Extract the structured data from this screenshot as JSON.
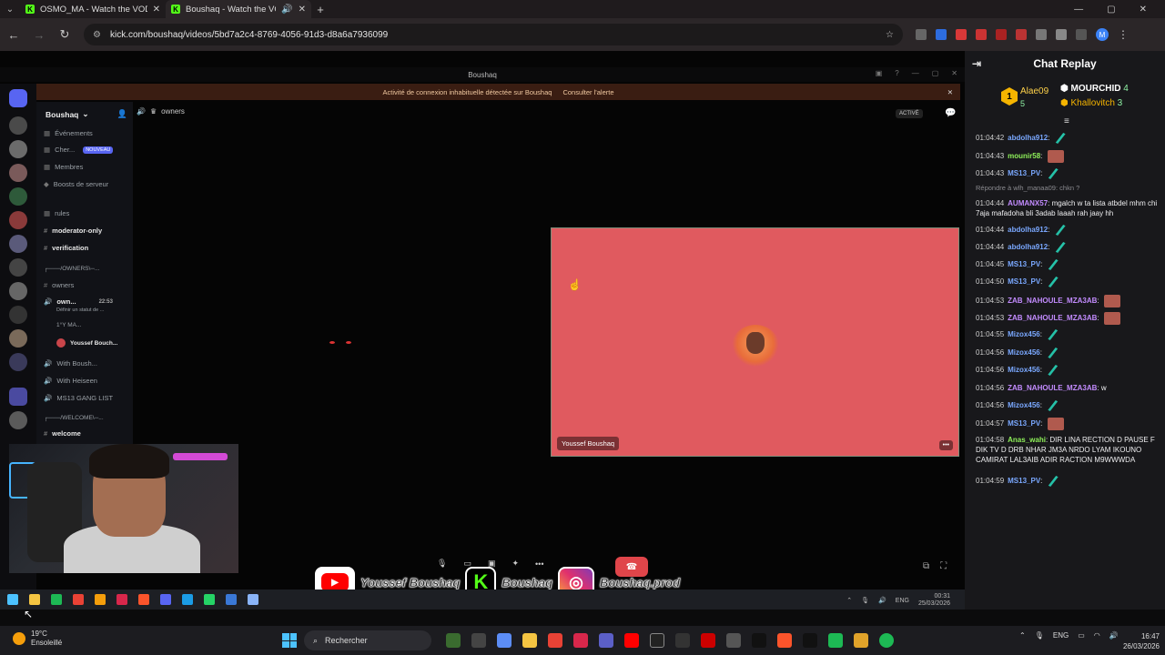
{
  "browser": {
    "tabs": [
      {
        "title": "OSMO_MA - Watch the VOD o"
      },
      {
        "title": "Boushaq - Watch the VOD o"
      }
    ],
    "url": "kick.com/boushaq/videos/5bd7a2c4-8769-4056-91d3-d8a6a7936099",
    "profile_initial": "M"
  },
  "discord": {
    "window_title": "Boushaq",
    "alert_text": "Activité de connexion inhabituelle détectée sur Boushaq",
    "alert_link": "Consulter l'alerte",
    "server_name": "Boushaq",
    "channel_header": "owners",
    "status_pill": "ACTIVÉ",
    "channels": [
      {
        "label": "Événements"
      },
      {
        "label": "Cher...",
        "badge": "NOUVEAU"
      },
      {
        "label": "Membres"
      },
      {
        "label": "Boosts de serveur"
      },
      {
        "label": "rules"
      },
      {
        "label": "moderator-only"
      },
      {
        "label": "verification"
      },
      {
        "label": "┌───/OWNERS\\─..."
      },
      {
        "label": "owners"
      },
      {
        "label": "own...",
        "time": "22:53"
      },
      {
        "label": "Définir un statut de ..."
      },
      {
        "label": "1°Y MA..."
      },
      {
        "label": "Youssef Bouch..."
      },
      {
        "label": "With Boush..."
      },
      {
        "label": "With Heiseen"
      },
      {
        "label": "MS13 GANG LIST"
      },
      {
        "label": "┌───/WELCOME\\─..."
      },
      {
        "label": "welcome"
      }
    ],
    "tile_name": "Youssef Boushaq"
  },
  "overlay": {
    "youtube": "Youssef Boushaq",
    "kick": "Boushaq",
    "instagram": "Boushaq.prod"
  },
  "inner_taskbar": {
    "lang": "ENG",
    "time": "00:31",
    "date": "25/03/2026"
  },
  "chat": {
    "title": "Chat Replay",
    "leaderboard": {
      "first_rank": "1",
      "first_name": "Alae09",
      "first_count": "5",
      "second_name": "MOURCHID",
      "second_count": "4",
      "third_name": "Khallovitch",
      "third_count": "3"
    },
    "reply_note": "Répondre à wlh_manaa09: chkn ?",
    "messages": [
      {
        "time": "01:04:42",
        "user": "abdolha912",
        "color": "#7aa8ff",
        "text": "",
        "emote": "feather"
      },
      {
        "time": "01:04:43",
        "user": "mounir58",
        "color": "#8ef05a",
        "text": "",
        "emote": "face"
      },
      {
        "time": "01:04:43",
        "user": "MS13_PV",
        "color": "#7aa8ff",
        "text": "",
        "emote": "feather"
      },
      {
        "time": "01:04:44",
        "user": "AUMANX57",
        "color": "#c38cff",
        "text": "mgalch w ta lista atbdel mhm chi 7aja mafadoha bli 3adab laaah rah jaay hh",
        "emote": ""
      },
      {
        "time": "01:04:44",
        "user": "abdolha912",
        "color": "#7aa8ff",
        "text": "",
        "emote": "feather"
      },
      {
        "time": "01:04:44",
        "user": "abdolha912",
        "color": "#7aa8ff",
        "text": "",
        "emote": "feather"
      },
      {
        "time": "01:04:45",
        "user": "MS13_PV",
        "color": "#7aa8ff",
        "text": "",
        "emote": "feather"
      },
      {
        "time": "01:04:50",
        "user": "MS13_PV",
        "color": "#7aa8ff",
        "text": "",
        "emote": "feather"
      },
      {
        "time": "01:04:53",
        "user": "ZAB_NAHOULE_MZA3AB",
        "color": "#c38cff",
        "text": "",
        "emote": "face"
      },
      {
        "time": "01:04:53",
        "user": "ZAB_NAHOULE_MZA3AB",
        "color": "#c38cff",
        "text": "",
        "emote": "face"
      },
      {
        "time": "01:04:55",
        "user": "Mizox456",
        "color": "#7aa8ff",
        "text": "",
        "emote": "feather"
      },
      {
        "time": "01:04:56",
        "user": "Mizox456",
        "color": "#7aa8ff",
        "text": "",
        "emote": "feather"
      },
      {
        "time": "01:04:56",
        "user": "Mizox456",
        "color": "#7aa8ff",
        "text": "",
        "emote": "feather"
      },
      {
        "time": "01:04:56",
        "user": "ZAB_NAHOULE_MZA3AB",
        "color": "#c38cff",
        "text": "w",
        "emote": ""
      },
      {
        "time": "01:04:56",
        "user": "Mizox456",
        "color": "#7aa8ff",
        "text": "",
        "emote": "feather"
      },
      {
        "time": "01:04:57",
        "user": "MS13_PV",
        "color": "#7aa8ff",
        "text": "",
        "emote": "face"
      },
      {
        "time": "01:04:58",
        "user": "Anas_wahi",
        "color": "#8ef05a",
        "text": "DIR LINA RECTION D PAUSE F DIK TV D DRB NHAR JM3A NRDO LYAM IKOUNO CAMIRAT LAL3AIB ADIR RACTION M9WWWDA",
        "emote": ""
      },
      {
        "time": "01:04:59",
        "user": "MS13_PV",
        "color": "#7aa8ff",
        "text": "",
        "emote": "feather"
      }
    ]
  },
  "taskbar": {
    "temp": "19°C",
    "weather": "Ensoleillé",
    "search_placeholder": "Rechercher",
    "lang": "ENG",
    "time": "16:47",
    "date": "26/03/2026"
  }
}
